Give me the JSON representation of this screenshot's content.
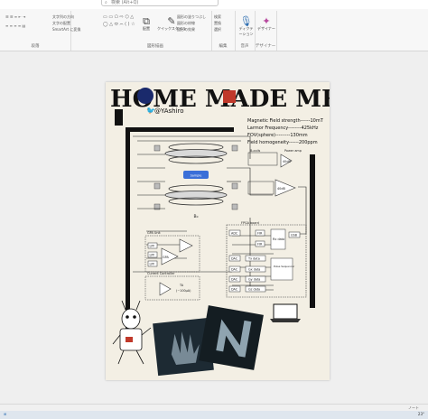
{
  "app": {
    "search_placeholder": "検索 (Alt+Q)"
  },
  "ribbon": {
    "groups": [
      {
        "label": "段落"
      },
      {
        "label": "図形描画"
      },
      {
        "label": "編集"
      },
      {
        "label": "音声"
      },
      {
        "label": "デザイナー"
      }
    ],
    "items": {
      "text_direction": "文字列の方向",
      "align_text": "文字の配置",
      "smartart": "SmartArt に変換",
      "arrange": "配置",
      "quick_styles": "クイックスタイル",
      "shape_fill": "図形の塗りつぶし",
      "shape_outline": "図形の枠線",
      "shape_effects": "図形の効果",
      "find": "検索",
      "replace": "置換",
      "select": "選択",
      "dictate": "ディクテーション",
      "designer": "デザイナー"
    }
  },
  "poster": {
    "title": "HOME MADE MRI",
    "handle": "@YAshiro",
    "specs": [
      "Magnetic Field strength------10mT",
      "Larmor Frequency--------425kHz",
      "FOV(sphere)---------130mm",
      "Field homogeneity------200ppm"
    ],
    "diagram": {
      "b0": "B₀",
      "gpa_unit": "GPA Unit",
      "gpa": "GPA",
      "fpga_board": "FPGA board",
      "current_controller": "Current Controller",
      "ta": "TA",
      "ta_range": "(~100µA)",
      "usb": "USB",
      "rx_data": "Rx data",
      "pulse_sequencer": "Pulse Sequencer",
      "tx_data": "Tx data",
      "gx_data": "Gx data",
      "gy_data": "Gy data",
      "gz_data": "Gz data",
      "adc": "ADC",
      "dac": "DAC",
      "lpf": "LPF",
      "fir": "FIR",
      "coil_label": "B₀coils",
      "preamp": "40dB",
      "amp": "40dB",
      "lna_label": "Power amp"
    }
  },
  "status": {
    "left": "",
    "notes": "ノート",
    "temp": "23°"
  }
}
